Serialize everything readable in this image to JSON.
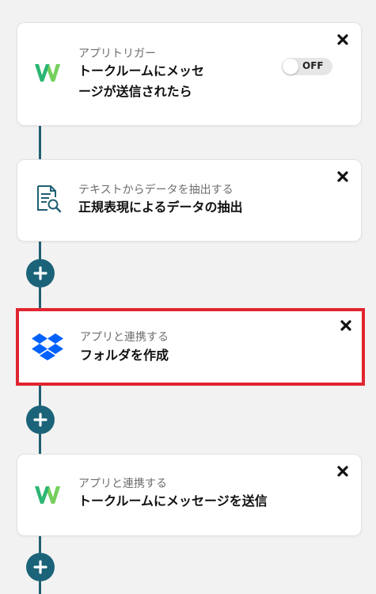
{
  "steps": [
    {
      "subtitle": "アプリトリガー",
      "title_line1": "トークルームにメッセ",
      "title_line2": "ージが送信されたら",
      "icon": "chatwork-icon",
      "toggle_label": "OFF"
    },
    {
      "subtitle": "テキストからデータを抽出する",
      "title": "正規表現によるデータの抽出",
      "icon": "document-search-icon"
    },
    {
      "subtitle": "アプリと連携する",
      "title": "フォルダを作成",
      "icon": "dropbox-icon"
    },
    {
      "subtitle": "アプリと連携する",
      "title": "トークルームにメッセージを送信",
      "icon": "chatwork-icon"
    }
  ],
  "colors": {
    "connector": "#1f5f72",
    "plus_button": "#1b6378",
    "highlight_border": "#e0252e",
    "chatwork_green": "#2bb673",
    "dropbox_blue": "#0061fe"
  }
}
